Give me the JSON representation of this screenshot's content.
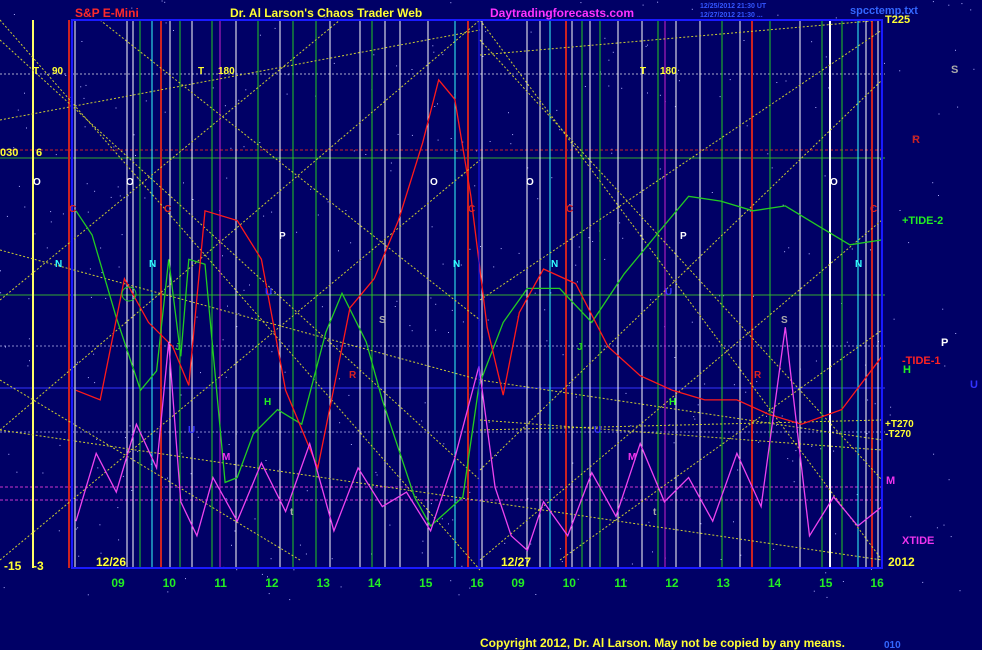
{
  "header": {
    "symbol": "S&P E-Mini",
    "title": "Dr. Al Larson's Chaos Trader Web",
    "site": "Daytradingforecasts.com",
    "timestamp_line1": "12/25/2012 21:30 UT",
    "timestamp_line2": "12/27/2012 21:30 ...",
    "file": "spcctemp.txt"
  },
  "footer": {
    "copyright": "Copyright 2012, Dr. Al Larson. May not be copied by any means.",
    "corner": "010"
  },
  "colors": {
    "background": "#000066",
    "plot_border": "#0000ff",
    "tide_red": "#ff1a1a",
    "tide_green": "#22cc22",
    "xtide": "#ee44ee",
    "gann_lines": "#cccc33"
  },
  "chart_data": {
    "type": "line",
    "x_unit": "hour of day (two sessions)",
    "sessions": [
      {
        "date_label": "12/26",
        "hours": [
          "09",
          "10",
          "11",
          "12",
          "13",
          "14",
          "15",
          "16"
        ]
      },
      {
        "date_label": "12/27",
        "hours": [
          "09",
          "10",
          "11",
          "12",
          "13",
          "14",
          "15",
          "16"
        ]
      }
    ],
    "year_label": "2012",
    "left_labels": {
      "top": "-15",
      "bottom": "-3"
    },
    "time_marks": [
      {
        "text": "T",
        "value": "90"
      },
      {
        "text": "T",
        "value": "180"
      },
      {
        "text": "T",
        "value": "180"
      }
    ],
    "left_side_values": [
      "030",
      "6"
    ],
    "top_right_label": "T225",
    "right_labels": [
      {
        "text": "S",
        "color": "#aaaaaa"
      },
      {
        "text": "R",
        "color": "#cc2222"
      },
      {
        "text": "+TIDE-2",
        "color": "#22ee22"
      },
      {
        "text": "P",
        "color": "#ffffff"
      },
      {
        "text": "-TIDE-1",
        "color": "#ff2222"
      },
      {
        "text": "U",
        "color": "#3333ff"
      },
      {
        "text": "H",
        "color": "#22ee22"
      },
      {
        "text": "+T270",
        "color": "#ffff33"
      },
      {
        "text": "-T270",
        "color": "#ffff33"
      },
      {
        "text": "M",
        "color": "#ee33ee"
      },
      {
        "text": "XTIDE",
        "color": "#ee33ee"
      }
    ],
    "planet_markers": [
      "O",
      "C",
      "N",
      "J",
      "P",
      "R",
      "S",
      "M",
      "H",
      "U",
      "t"
    ],
    "series": [
      {
        "name": "+TIDE-2",
        "color": "#22cc22",
        "x": [
          0,
          0.02,
          0.05,
          0.08,
          0.1,
          0.115,
          0.13,
          0.14,
          0.16,
          0.185,
          0.2,
          0.22,
          0.25,
          0.28,
          0.31,
          0.33,
          0.36,
          0.38,
          0.4,
          0.42,
          0.44,
          0.46,
          0.48,
          0.5,
          0.53,
          0.56,
          0.6,
          0.64,
          0.68,
          0.72,
          0.76,
          0.8,
          0.84,
          0.88,
          0.92,
          0.96,
          1.0
        ],
        "y": [
          0.72,
          0.67,
          0.5,
          0.35,
          0.39,
          0.62,
          0.42,
          0.62,
          0.61,
          0.16,
          0.17,
          0.26,
          0.31,
          0.28,
          0.47,
          0.55,
          0.45,
          0.33,
          0.23,
          0.13,
          0.07,
          0.1,
          0.13,
          0.36,
          0.49,
          0.56,
          0.56,
          0.49,
          0.59,
          0.67,
          0.75,
          0.74,
          0.72,
          0.73,
          0.69,
          0.65,
          0.66
        ]
      },
      {
        "name": "-TIDE-1",
        "color": "#ff1a1a",
        "x": [
          0,
          0.03,
          0.06,
          0.09,
          0.12,
          0.14,
          0.16,
          0.2,
          0.23,
          0.26,
          0.3,
          0.34,
          0.37,
          0.4,
          0.43,
          0.45,
          0.47,
          0.49,
          0.51,
          0.53,
          0.55,
          0.58,
          0.62,
          0.66,
          0.7,
          0.74,
          0.78,
          0.82,
          0.86,
          0.9,
          0.95,
          1.0
        ],
        "y": [
          0.35,
          0.33,
          0.58,
          0.49,
          0.44,
          0.36,
          0.72,
          0.7,
          0.62,
          0.35,
          0.19,
          0.52,
          0.58,
          0.7,
          0.86,
          0.99,
          0.95,
          0.75,
          0.48,
          0.34,
          0.51,
          0.6,
          0.57,
          0.44,
          0.38,
          0.35,
          0.33,
          0.33,
          0.3,
          0.28,
          0.31,
          0.42
        ]
      },
      {
        "name": "XTIDE",
        "color": "#ee44ee",
        "x": [
          0,
          0.025,
          0.05,
          0.075,
          0.1,
          0.115,
          0.13,
          0.15,
          0.17,
          0.2,
          0.23,
          0.26,
          0.29,
          0.32,
          0.35,
          0.38,
          0.41,
          0.44,
          0.47,
          0.5,
          0.52,
          0.54,
          0.56,
          0.58,
          0.61,
          0.64,
          0.67,
          0.7,
          0.73,
          0.76,
          0.79,
          0.82,
          0.85,
          0.88,
          0.91,
          0.94,
          0.97,
          1.0
        ],
        "y": [
          0.08,
          0.22,
          0.14,
          0.28,
          0.19,
          0.45,
          0.12,
          0.05,
          0.17,
          0.08,
          0.2,
          0.1,
          0.24,
          0.06,
          0.19,
          0.11,
          0.14,
          0.06,
          0.21,
          0.4,
          0.15,
          0.05,
          0.02,
          0.12,
          0.05,
          0.18,
          0.09,
          0.24,
          0.12,
          0.17,
          0.08,
          0.22,
          0.11,
          0.48,
          0.05,
          0.13,
          0.07,
          0.11
        ]
      }
    ],
    "xlim": [
      0,
      1
    ],
    "ylim": [
      0,
      1
    ]
  }
}
